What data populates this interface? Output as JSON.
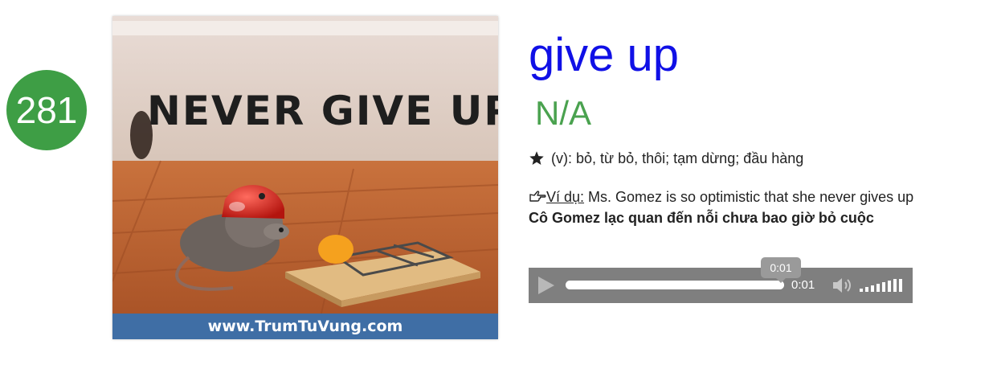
{
  "entry": {
    "number": "281",
    "word": "give up",
    "pronunciation": "N/A",
    "meaning": "(v): bỏ, từ bỏ, thôi; tạm dừng; đầu hàng",
    "example_label": "Ví dụ:",
    "example": " Ms. Gomez is so optimistic that she never gives up",
    "translation": "Cô Gomez lạc quan đến nỗi chưa bao giờ bỏ cuộc"
  },
  "image": {
    "headline": "NEVER GIVE UP",
    "caption": "www.TrumTuVung.com"
  },
  "audio": {
    "current_time": "0:01",
    "tooltip_time": "0:01",
    "progress": 1.0
  },
  "icons": {
    "meaning": "star-icon",
    "example": "pointing-hand-icon",
    "play": "play-icon",
    "volume": "speaker-icon"
  },
  "colors": {
    "number_badge": "#3e9e45",
    "word": "#1010e6",
    "pronunciation": "#4aa24f",
    "caption_bar": "#3f6ea5",
    "player_bg": "#7f7f7f"
  }
}
